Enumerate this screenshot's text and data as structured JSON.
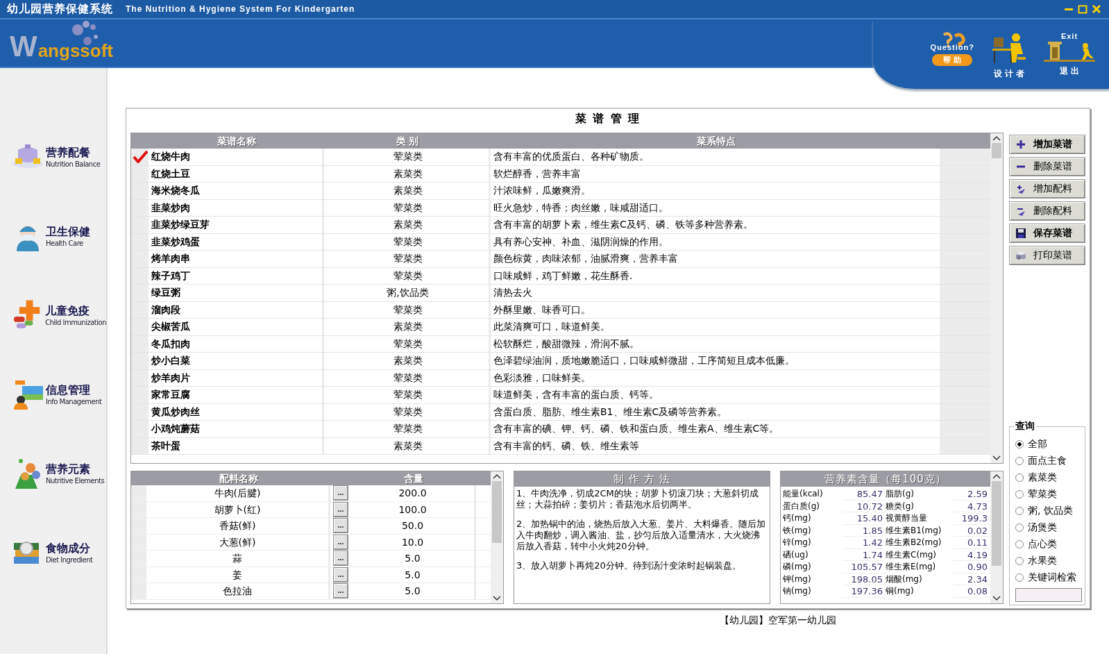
{
  "window": {
    "title": "幼儿园营养保健系统",
    "subtitle": "The Nutrition & Hygiene System For Kindergarten"
  },
  "logo": {
    "mark": "W",
    "text": "angssoft"
  },
  "header_tools": [
    {
      "kind": "help",
      "caption": "Question?",
      "label": "帮 助"
    },
    {
      "kind": "designer",
      "label": "设 计 者"
    },
    {
      "kind": "exit",
      "caption": "Exit",
      "label": "退 出"
    }
  ],
  "sidebar": {
    "items": [
      {
        "label": "营养配餐",
        "sublabel": "Nutrition Balance"
      },
      {
        "label": "卫生保健",
        "sublabel": "Health  Care"
      },
      {
        "label": "儿童免疫",
        "sublabel": "Child Immunization"
      },
      {
        "label": "信息管理",
        "sublabel": "Info Management"
      },
      {
        "label": "营养元素",
        "sublabel": "Nutritive Elements"
      },
      {
        "label": "食物成分",
        "sublabel": "Diet Ingredient"
      }
    ]
  },
  "panel": {
    "title": "菜 谱 管 理"
  },
  "recipes": {
    "columns": [
      "菜谱名称",
      "类 别",
      "菜系特点"
    ],
    "rows": [
      {
        "name": "红烧牛肉",
        "category": "荤菜类",
        "feature": "含有丰富的优质蛋白、各种矿物质。",
        "selected": true
      },
      {
        "name": "红烧土豆",
        "category": "素菜类",
        "feature": "软烂醇香，营养丰富",
        "selected": false
      },
      {
        "name": "海米烧冬瓜",
        "category": "素菜类",
        "feature": "汁浓味鲜，瓜嫩爽滑。",
        "selected": false
      },
      {
        "name": "韭菜炒肉",
        "category": "荤菜类",
        "feature": "旺火急炒，特香；肉丝嫩，味咸甜适口。",
        "selected": false
      },
      {
        "name": "韭菜炒绿豆芽",
        "category": "素菜类",
        "feature": "含有丰富的胡萝卜素，维生素C及钙、磷、铁等多种营养素。",
        "selected": false
      },
      {
        "name": "韭菜炒鸡蛋",
        "category": "荤菜类",
        "feature": "具有养心安神、补血、滋阴润燥的作用。",
        "selected": false
      },
      {
        "name": "烤羊肉串",
        "category": "荤菜类",
        "feature": "颜色棕黄，肉味浓郁，油腻滑爽，营养丰富",
        "selected": false
      },
      {
        "name": "辣子鸡丁",
        "category": "荤菜类",
        "feature": "口味咸鲜，鸡丁鲜嫩，花生酥香.",
        "selected": false
      },
      {
        "name": "绿豆粥",
        "category": "粥,饮品类",
        "feature": "清热去火",
        "selected": false
      },
      {
        "name": "溜肉段",
        "category": "荤菜类",
        "feature": "外酥里嫩、味香可口。",
        "selected": false
      },
      {
        "name": "尖椒苦瓜",
        "category": "素菜类",
        "feature": "此菜清爽可口，味道鲜美。",
        "selected": false
      },
      {
        "name": "冬瓜扣肉",
        "category": "荤菜类",
        "feature": "松软酥烂，酸甜微辣，滑润不腻。",
        "selected": false
      },
      {
        "name": "炒小白菜",
        "category": "素菜类",
        "feature": "色泽碧绿油润，质地嫩脆适口，口味咸鲜微甜，工序简短且成本低廉。",
        "selected": false
      },
      {
        "name": "炒羊肉片",
        "category": "荤菜类",
        "feature": "色彩淡雅，口味鲜美。",
        "selected": false
      },
      {
        "name": "家常豆腐",
        "category": "荤菜类",
        "feature": "味道鲜美，含有丰富的蛋白质、钙等。",
        "selected": false
      },
      {
        "name": "黄瓜炒肉丝",
        "category": "荤菜类",
        "feature": "含蛋白质、脂肪、维生素B1、维生素C及磷等营养素。",
        "selected": false
      },
      {
        "name": "小鸡炖蘑菇",
        "category": "荤菜类",
        "feature": "含有丰富的碘、钾、钙、磷、铁和蛋白质、维生素A、维生素C等。",
        "selected": false
      },
      {
        "name": "茶叶蛋",
        "category": "素菜类",
        "feature": "含有丰富的钙、磷、铁、维生素等",
        "selected": false
      }
    ]
  },
  "actions": [
    {
      "label": "增加菜谱",
      "bold": true
    },
    {
      "label": "删除菜谱",
      "bold": false
    },
    {
      "label": "增加配料",
      "bold": false
    },
    {
      "label": "删除配料",
      "bold": false
    },
    {
      "label": "保存菜谱",
      "bold": true
    },
    {
      "label": "打印菜谱",
      "bold": false
    }
  ],
  "query": {
    "title": "查询",
    "options": [
      {
        "label": "全部",
        "selected": true
      },
      {
        "label": "面点主食",
        "selected": false
      },
      {
        "label": "素菜类",
        "selected": false
      },
      {
        "label": "荤菜类",
        "selected": false
      },
      {
        "label": "粥, 饮品类",
        "selected": false
      },
      {
        "label": "汤煲类",
        "selected": false
      },
      {
        "label": "点心类",
        "selected": false
      },
      {
        "label": "水果类",
        "selected": false
      },
      {
        "label": "关键词检索",
        "selected": false
      }
    ]
  },
  "ingredients": {
    "columns": [
      "配料名称",
      "含量"
    ],
    "button": "...",
    "rows": [
      {
        "name": "牛肉(后腱)",
        "amount": "200.0"
      },
      {
        "name": "胡萝卜(红)",
        "amount": "100.0"
      },
      {
        "name": "香菇(鲜)",
        "amount": "50.0"
      },
      {
        "name": "大葱(鲜)",
        "amount": "10.0"
      },
      {
        "name": "蒜",
        "amount": "5.0"
      },
      {
        "name": "姜",
        "amount": "5.0"
      },
      {
        "name": "色拉油",
        "amount": "5.0"
      }
    ]
  },
  "method": {
    "title": "制 作 方 法",
    "steps": [
      "1、牛肉洗净，切成2CM的块；胡萝卜切滚刀块；大葱斜切成丝；大蒜拍碎；姜切片；香菇泡水后切两半。",
      "2、加热锅中的油，烧热后放入大葱、姜片、大料爆香。随后加入牛肉翻炒，调入酱油、盐，抄匀后放入适量清水，大火烧沸后放入香菇，转中小火炖20分钟。",
      "3、放入胡萝卜再炖20分钟。待到汤汁变浓时起锅装盘。"
    ]
  },
  "nutrition": {
    "title": "营养素含量（每100克）",
    "items": [
      {
        "label": "能量(kcal)",
        "value": "85.47"
      },
      {
        "label": "脂肪(g)",
        "value": "2.59"
      },
      {
        "label": "蛋白质(g)",
        "value": "10.72"
      },
      {
        "label": "糖类(g)",
        "value": "4.73"
      },
      {
        "label": "钙(mg)",
        "value": "15.40"
      },
      {
        "label": "视黄醇当量",
        "value": "199.3"
      },
      {
        "label": "铁(mg)",
        "value": "1.85"
      },
      {
        "label": "维生素B1(mg)",
        "value": "0.02"
      },
      {
        "label": "锌(mg)",
        "value": "1.42"
      },
      {
        "label": "维生素B2(mg)",
        "value": "0.11"
      },
      {
        "label": "硒(ug)",
        "value": "1.74"
      },
      {
        "label": "维生素C(mg)",
        "value": "4.19"
      },
      {
        "label": "磷(mg)",
        "value": "105.57"
      },
      {
        "label": "维生素E(mg)",
        "value": "0.90"
      },
      {
        "label": "钾(mg)",
        "value": "198.05"
      },
      {
        "label": "烟酸(mg)",
        "value": "2.34"
      },
      {
        "label": "钠(mg)",
        "value": "197.36"
      },
      {
        "label": "铜(mg)",
        "value": "0.08"
      }
    ]
  },
  "status_bar": {
    "text": "【幼儿园】空军第一幼儿园"
  }
}
